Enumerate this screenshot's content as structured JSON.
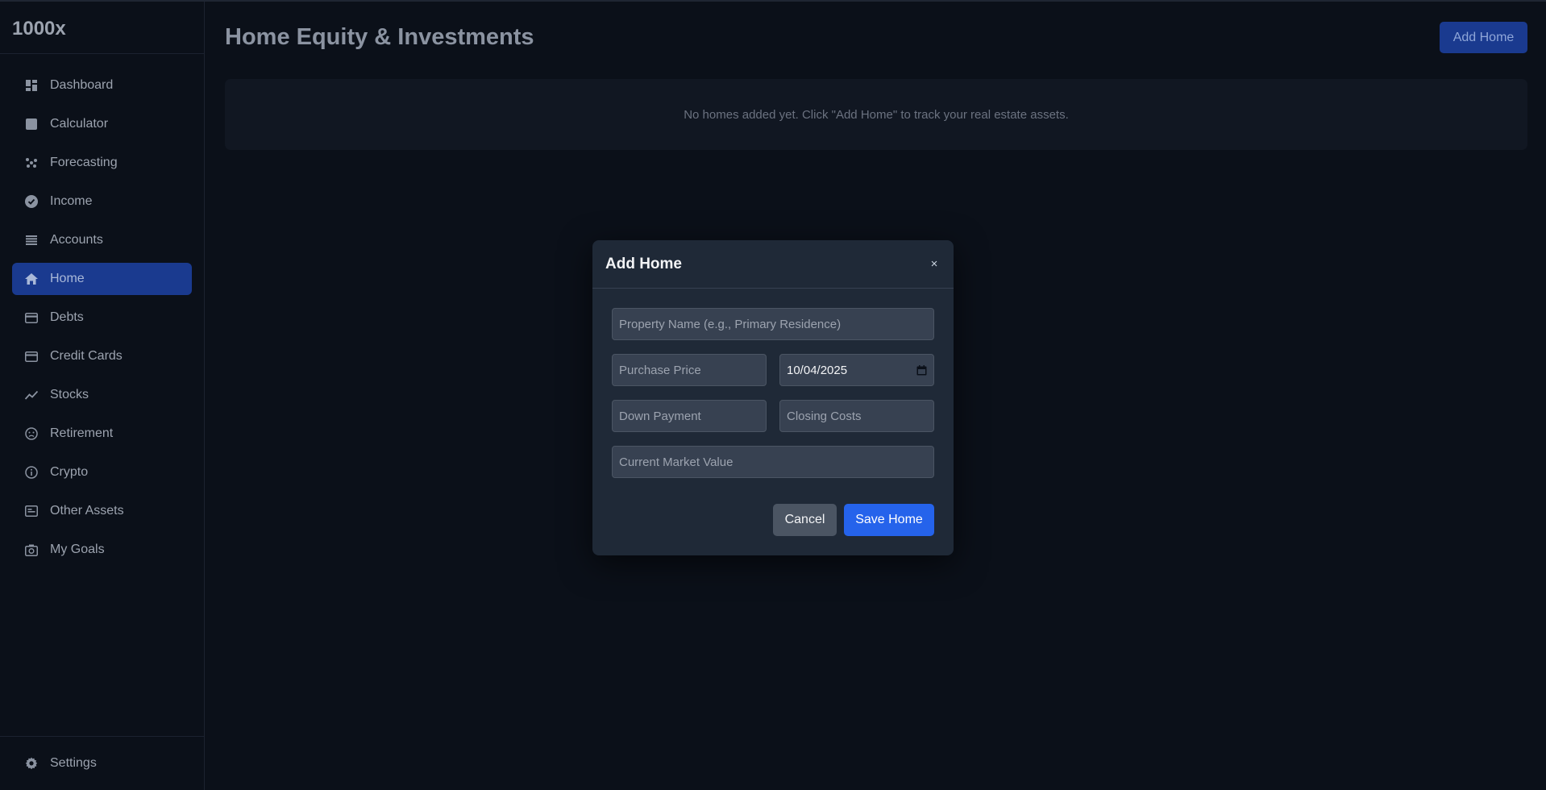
{
  "app": {
    "brand": "1000x"
  },
  "sidebar": {
    "items": [
      {
        "label": "Dashboard",
        "icon": "dashboard-icon"
      },
      {
        "label": "Calculator",
        "icon": "calculator-icon"
      },
      {
        "label": "Forecasting",
        "icon": "forecasting-icon"
      },
      {
        "label": "Income",
        "icon": "income-icon"
      },
      {
        "label": "Accounts",
        "icon": "accounts-icon"
      },
      {
        "label": "Home",
        "icon": "home-icon",
        "active": true
      },
      {
        "label": "Debts",
        "icon": "debts-icon"
      },
      {
        "label": "Credit Cards",
        "icon": "credit-card-icon"
      },
      {
        "label": "Stocks",
        "icon": "stocks-icon"
      },
      {
        "label": "Retirement",
        "icon": "retirement-icon"
      },
      {
        "label": "Crypto",
        "icon": "crypto-icon"
      },
      {
        "label": "Other Assets",
        "icon": "other-assets-icon"
      },
      {
        "label": "My Goals",
        "icon": "goals-icon"
      }
    ],
    "footer": {
      "label": "Settings",
      "icon": "gear-icon"
    }
  },
  "main": {
    "title": "Home Equity & Investments",
    "add_button": "Add Home",
    "empty_message": "No homes added yet. Click \"Add Home\" to track your real estate assets."
  },
  "modal": {
    "title": "Add Home",
    "close_glyph": "×",
    "fields": {
      "property_name": {
        "placeholder": "Property Name (e.g., Primary Residence)",
        "value": ""
      },
      "purchase_price": {
        "placeholder": "Purchase Price",
        "value": ""
      },
      "purchase_date": {
        "value": "10/04/2025"
      },
      "down_payment": {
        "placeholder": "Down Payment",
        "value": ""
      },
      "closing_costs": {
        "placeholder": "Closing Costs",
        "value": ""
      },
      "market_value": {
        "placeholder": "Current Market Value",
        "value": ""
      }
    },
    "cancel_label": "Cancel",
    "save_label": "Save Home"
  },
  "colors": {
    "background": "#0b1019",
    "active_nav": "#1a3a8f",
    "modal_bg": "#1f2937",
    "primary": "#2563eb",
    "secondary_button": "#4b5563"
  }
}
